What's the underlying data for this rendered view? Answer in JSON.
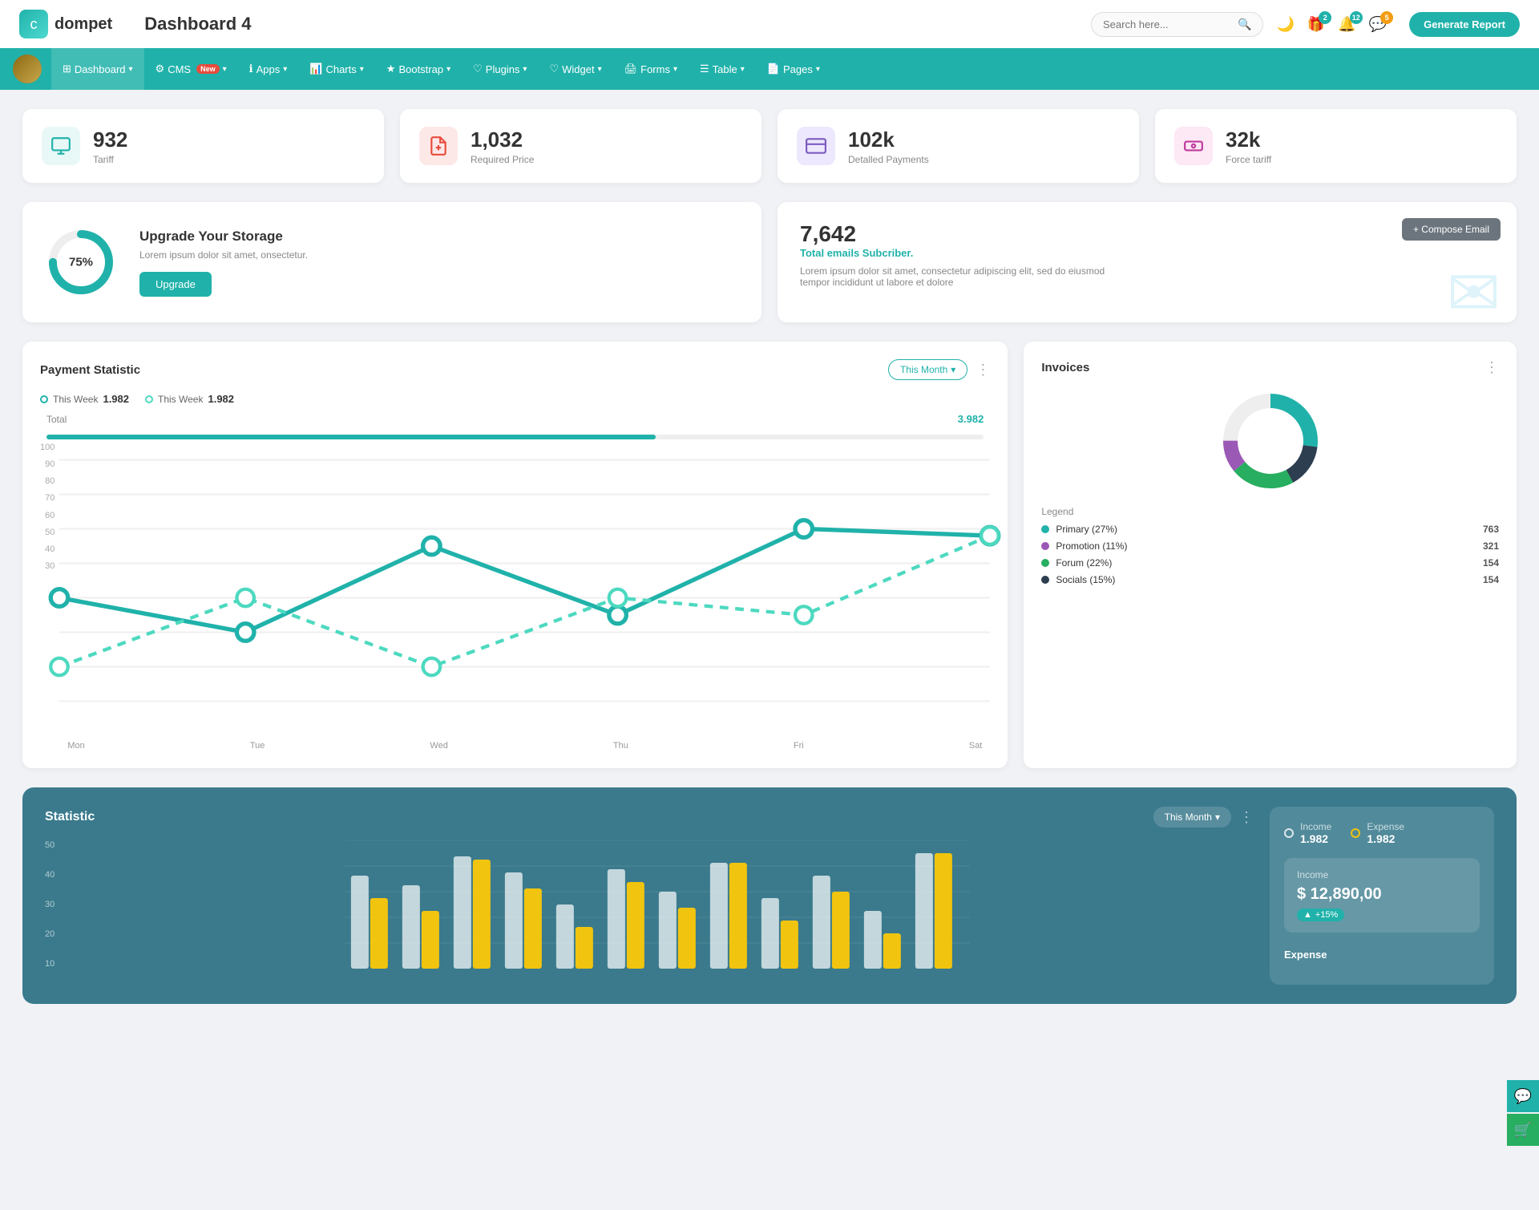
{
  "header": {
    "logo_text": "dompet",
    "page_title": "Dashboard 4",
    "search_placeholder": "Search here...",
    "dark_mode_icon": "🌙",
    "gift_icon": "🎁",
    "generate_btn": "Generate Report",
    "notifications": [
      {
        "icon": "🛍",
        "badge": "2",
        "badge_color": "teal"
      },
      {
        "icon": "🔔",
        "badge": "12",
        "badge_color": "teal"
      },
      {
        "icon": "💬",
        "badge": "5",
        "badge_color": "teal"
      }
    ]
  },
  "navbar": {
    "items": [
      {
        "label": "Dashboard",
        "active": true,
        "has_arrow": true
      },
      {
        "label": "CMS",
        "has_arrow": true,
        "is_new": true
      },
      {
        "label": "Apps",
        "has_arrow": true
      },
      {
        "label": "Charts",
        "has_arrow": true
      },
      {
        "label": "Bootstrap",
        "has_arrow": true
      },
      {
        "label": "Plugins",
        "has_arrow": true
      },
      {
        "label": "Widget",
        "has_arrow": true
      },
      {
        "label": "Forms",
        "has_arrow": true
      },
      {
        "label": "Table",
        "has_arrow": true
      },
      {
        "label": "Pages",
        "has_arrow": true
      }
    ]
  },
  "stat_cards": [
    {
      "value": "932",
      "label": "Tariff",
      "icon_type": "teal",
      "icon": "⊞"
    },
    {
      "value": "1,032",
      "label": "Required Price",
      "icon_type": "red",
      "icon": "📄"
    },
    {
      "value": "102k",
      "label": "Detalled Payments",
      "icon_type": "purple",
      "icon": "⊞"
    },
    {
      "value": "32k",
      "label": "Force tariff",
      "icon_type": "pink",
      "icon": "⊞"
    }
  ],
  "storage_card": {
    "percent": "75%",
    "title": "Upgrade Your Storage",
    "desc": "Lorem ipsum dolor sit amet, onsectetur.",
    "btn_label": "Upgrade",
    "percent_num": 75
  },
  "email_card": {
    "count": "7,642",
    "subtitle": "Total emails Subcriber.",
    "desc": "Lorem ipsum dolor sit amet, consectetur adipiscing elit, sed do eiusmod tempor incididunt ut labore et dolore",
    "compose_btn": "+ Compose Email"
  },
  "payment_chart": {
    "title": "Payment Statistic",
    "this_month_label": "This Month",
    "legend": [
      {
        "label": "This Week",
        "value": "1.982"
      },
      {
        "label": "This Week",
        "value": "1.982"
      }
    ],
    "total_label": "Total",
    "total_value": "3.982",
    "x_labels": [
      "Mon",
      "Tue",
      "Wed",
      "Thu",
      "Fri",
      "Sat"
    ],
    "y_labels": [
      "100",
      "90",
      "80",
      "70",
      "60",
      "50",
      "40",
      "30"
    ],
    "line1": [
      60,
      50,
      80,
      65,
      90,
      88
    ],
    "line2": [
      40,
      70,
      40,
      80,
      65,
      88
    ]
  },
  "invoices": {
    "title": "Invoices",
    "legend": [
      {
        "label": "Primary (27%)",
        "color": "#20b2aa",
        "count": "763"
      },
      {
        "label": "Promotion (11%)",
        "color": "#9b59b6",
        "count": "321"
      },
      {
        "label": "Forum (22%)",
        "color": "#27ae60",
        "count": "154"
      },
      {
        "label": "Socials (15%)",
        "color": "#2c3e50",
        "count": "154"
      }
    ],
    "legend_title": "Legend"
  },
  "statistic": {
    "title": "Statistic",
    "this_month_label": "This Month",
    "income_label": "Income",
    "income_value": "1.982",
    "expense_label": "Expense",
    "expense_value": "1.982",
    "income_section_label": "Income",
    "income_amount": "$ 12,890,00",
    "income_change": "+15%",
    "y_labels": [
      "50",
      "40",
      "30",
      "20",
      "10"
    ],
    "bars": [
      {
        "white": 35,
        "yellow": 20
      },
      {
        "white": 28,
        "yellow": 15
      },
      {
        "white": 42,
        "yellow": 38
      },
      {
        "white": 32,
        "yellow": 22
      },
      {
        "white": 18,
        "yellow": 10
      },
      {
        "white": 38,
        "yellow": 30
      },
      {
        "white": 25,
        "yellow": 18
      },
      {
        "white": 40,
        "yellow": 35
      },
      {
        "white": 20,
        "yellow": 12
      },
      {
        "white": 33,
        "yellow": 25
      },
      {
        "white": 15,
        "yellow": 8
      },
      {
        "white": 45,
        "yellow": 40
      }
    ]
  },
  "support": {
    "chat_icon": "💬",
    "cart_icon": "🛒"
  }
}
